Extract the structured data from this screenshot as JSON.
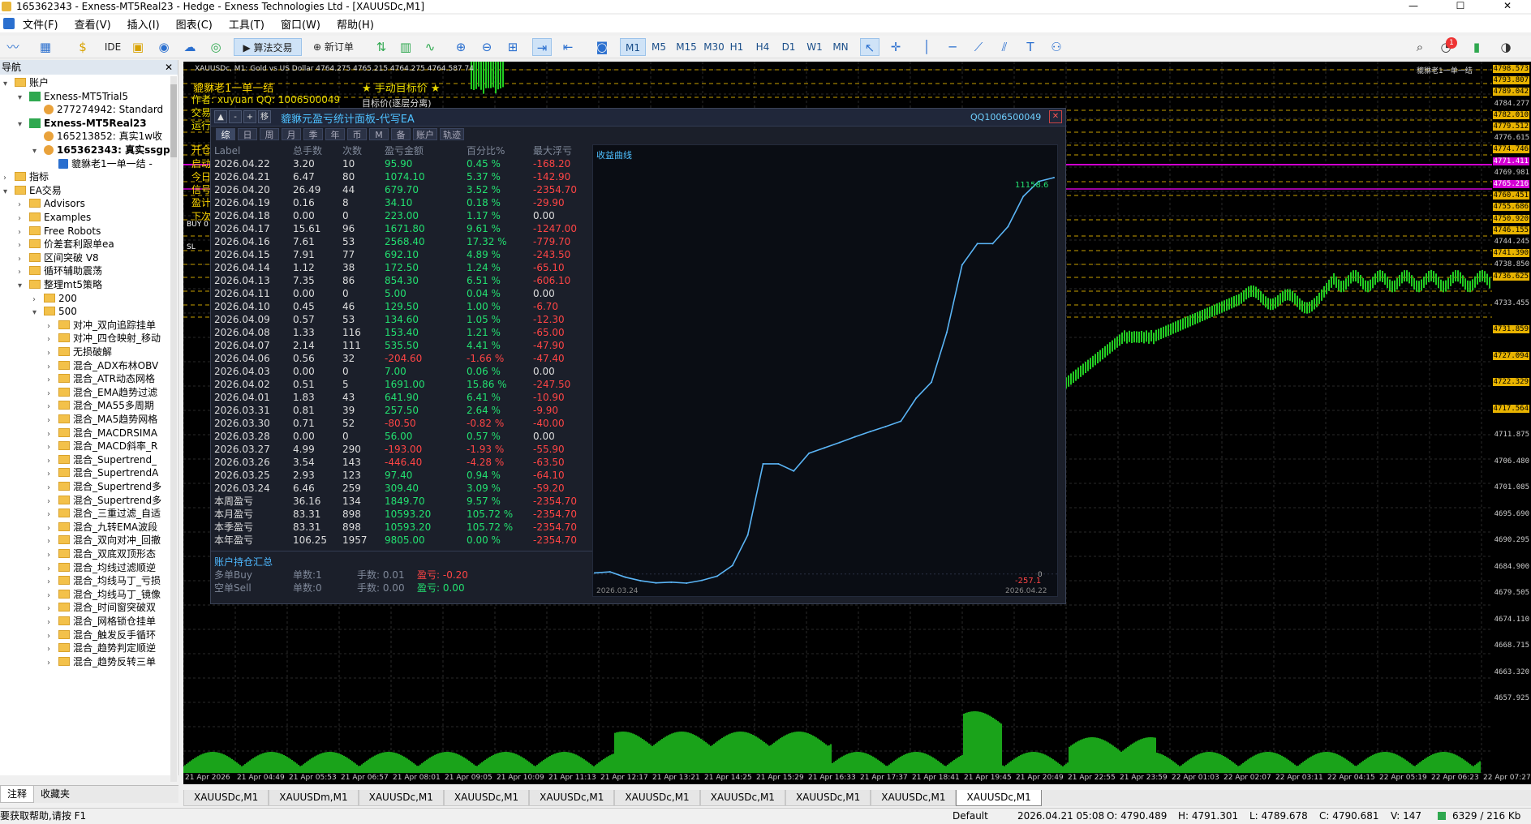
{
  "window": {
    "title": "165362343 - Exness-MT5Real23 - Hedge - Exness Technologies Ltd - [XAUUSDc,M1]",
    "minimize": "—",
    "maximize": "☐",
    "close": "✕"
  },
  "menu": [
    "文件(F)",
    "查看(V)",
    "插入(I)",
    "图表(C)",
    "工具(T)",
    "窗口(W)",
    "帮助(H)"
  ],
  "toolbar": {
    "algo": "算法交易",
    "neworder": "新订单",
    "ide": "IDE",
    "timeframes": [
      "M1",
      "M5",
      "M15",
      "M30",
      "H1",
      "H4",
      "D1",
      "W1",
      "MN"
    ],
    "active_tf": "M1",
    "notif_count": "1"
  },
  "navigator": {
    "title": "导航",
    "close": "✕",
    "items": [
      {
        "label": "账户",
        "indent": 0,
        "type": "folder",
        "exp": "▾"
      },
      {
        "label": "Exness-MT5Trial5",
        "indent": 1,
        "type": "server",
        "exp": "▾"
      },
      {
        "label": "277274942: Standard",
        "indent": 2,
        "type": "person",
        "exp": ""
      },
      {
        "label": "Exness-MT5Real23",
        "indent": 1,
        "type": "server",
        "exp": "▾",
        "bold": true
      },
      {
        "label": "165213852: 真实1w收",
        "indent": 2,
        "type": "person",
        "exp": ""
      },
      {
        "label": "165362343: 真实ssgp",
        "indent": 2,
        "type": "person",
        "exp": "▾",
        "bold": true
      },
      {
        "label": "貔貅老1一单一结 -",
        "indent": 3,
        "type": "ea",
        "exp": ""
      },
      {
        "label": "指标",
        "indent": 0,
        "type": "folder",
        "exp": "›"
      },
      {
        "label": "EA交易",
        "indent": 0,
        "type": "folder",
        "exp": "▾"
      },
      {
        "label": "Advisors",
        "indent": 1,
        "type": "folder",
        "exp": "›"
      },
      {
        "label": "Examples",
        "indent": 1,
        "type": "folder",
        "exp": "›"
      },
      {
        "label": "Free Robots",
        "indent": 1,
        "type": "folder",
        "exp": "›"
      },
      {
        "label": "价差套利跟单ea",
        "indent": 1,
        "type": "folder",
        "exp": "›"
      },
      {
        "label": "区间突破 V8",
        "indent": 1,
        "type": "folder",
        "exp": "›"
      },
      {
        "label": "循环辅助震荡",
        "indent": 1,
        "type": "folder",
        "exp": "›"
      },
      {
        "label": "整理mt5策略",
        "indent": 1,
        "type": "folder",
        "exp": "▾"
      },
      {
        "label": "200",
        "indent": 2,
        "type": "folder",
        "exp": "›"
      },
      {
        "label": "500",
        "indent": 2,
        "type": "folder",
        "exp": "▾"
      },
      {
        "label": "对冲_双向追踪挂单",
        "indent": 3,
        "type": "folder",
        "exp": "›"
      },
      {
        "label": "对冲_四仓映射_移动",
        "indent": 3,
        "type": "folder",
        "exp": "›"
      },
      {
        "label": "无损破解",
        "indent": 3,
        "type": "folder",
        "exp": "›"
      },
      {
        "label": "混合_ADX布林OBV",
        "indent": 3,
        "type": "folder",
        "exp": "›"
      },
      {
        "label": "混合_ATR动态网格",
        "indent": 3,
        "type": "folder",
        "exp": "›"
      },
      {
        "label": "混合_EMA趋势过滤",
        "indent": 3,
        "type": "folder",
        "exp": "›"
      },
      {
        "label": "混合_MA55多周期",
        "indent": 3,
        "type": "folder",
        "exp": "›"
      },
      {
        "label": "混合_MA5趋势网格",
        "indent": 3,
        "type": "folder",
        "exp": "›"
      },
      {
        "label": "混合_MACDRSIMA",
        "indent": 3,
        "type": "folder",
        "exp": "›"
      },
      {
        "label": "混合_MACD斜率_R",
        "indent": 3,
        "type": "folder",
        "exp": "›"
      },
      {
        "label": "混合_Supertrend_",
        "indent": 3,
        "type": "folder",
        "exp": "›"
      },
      {
        "label": "混合_SupertrendA",
        "indent": 3,
        "type": "folder",
        "exp": "›"
      },
      {
        "label": "混合_Supertrend多",
        "indent": 3,
        "type": "folder",
        "exp": "›"
      },
      {
        "label": "混合_Supertrend多",
        "indent": 3,
        "type": "folder",
        "exp": "›"
      },
      {
        "label": "混合_三重过滤_自适",
        "indent": 3,
        "type": "folder",
        "exp": "›"
      },
      {
        "label": "混合_九转EMA波段",
        "indent": 3,
        "type": "folder",
        "exp": "›"
      },
      {
        "label": "混合_双向对冲_回撤",
        "indent": 3,
        "type": "folder",
        "exp": "›"
      },
      {
        "label": "混合_双底双顶形态",
        "indent": 3,
        "type": "folder",
        "exp": "›"
      },
      {
        "label": "混合_均线过滤顺逆",
        "indent": 3,
        "type": "folder",
        "exp": "›"
      },
      {
        "label": "混合_均线马丁_亏损",
        "indent": 3,
        "type": "folder",
        "exp": "›"
      },
      {
        "label": "混合_均线马丁_镜像",
        "indent": 3,
        "type": "folder",
        "exp": "›"
      },
      {
        "label": "混合_时间窗突破双",
        "indent": 3,
        "type": "folder",
        "exp": "›"
      },
      {
        "label": "混合_网格锁仓挂单",
        "indent": 3,
        "type": "folder",
        "exp": "›"
      },
      {
        "label": "混合_触发反手循环",
        "indent": 3,
        "type": "folder",
        "exp": "›"
      },
      {
        "label": "混合_趋势判定顺逆",
        "indent": 3,
        "type": "folder",
        "exp": "›"
      },
      {
        "label": "混合_趋势反转三单",
        "indent": 3,
        "type": "folder",
        "exp": "›"
      }
    ],
    "tabs": [
      "注释",
      "收藏夹"
    ]
  },
  "chart": {
    "symbol_info": "XAUUSDc, M1: Gold vs US Dollar 4764.275 4765.215 4764.275 4764.587 74",
    "overlay_title": "貔貅老1一单一结",
    "overlay_author": "作者: xuyuan   QQ: 1006500049",
    "overlay_manual": "★ 手动目标价 ★",
    "overlay_target": "目标价(逐层分离)",
    "overlay_trade": "交易",
    "overlay_run": "运行",
    "ea_tag": "貔貅老1一单一结",
    "side_labels": [
      "开仓",
      "启动",
      "今日",
      "信号",
      "盈计",
      "下次"
    ],
    "buy_label": "BUY 0",
    "sl_label": "SL",
    "prices": [
      "4798.573",
      "4793.807",
      "4789.042",
      "4784.277",
      "4782.010",
      "4779.512",
      "4776.615",
      "4774.746",
      "4771.411",
      "4769.981",
      "4765.216",
      "4760.451",
      "4755.686",
      "4750.920",
      "4746.155",
      "4744.245",
      "4741.390",
      "4738.850",
      "4736.625",
      "4733.455",
      "4731.859",
      "4727.094",
      "4722.329",
      "4717.564",
      "4711.875",
      "4706.480",
      "4701.085",
      "4695.690",
      "4690.295",
      "4684.900",
      "4679.505",
      "4674.110",
      "4668.715",
      "4663.320",
      "4657.925"
    ],
    "times": [
      "21 Apr 2026",
      "21 Apr 04:49",
      "21 Apr 05:53",
      "21 Apr 06:57",
      "21 Apr 08:01",
      "21 Apr 09:05",
      "21 Apr 10:09",
      "21 Apr 11:13",
      "21 Apr 12:17",
      "21 Apr 13:21",
      "21 Apr 14:25",
      "21 Apr 15:29",
      "21 Apr 16:33",
      "21 Apr 17:37",
      "21 Apr 18:41",
      "21 Apr 19:45",
      "21 Apr 20:49",
      "21 Apr 22:55",
      "21 Apr 23:59",
      "22 Apr 01:03",
      "22 Apr 02:07",
      "22 Apr 03:11",
      "22 Apr 04:15",
      "22 Apr 05:19",
      "22 Apr 06:23",
      "22 Apr 07:27"
    ]
  },
  "panel": {
    "title": "貔貅元盈亏统计面板-代写EA",
    "qq": "QQ1006500049",
    "btns": [
      "▲",
      "-",
      "+",
      "移"
    ],
    "close": "✕",
    "tabs": [
      "综",
      "日",
      "周",
      "月",
      "季",
      "年",
      "币",
      "M",
      "备",
      "账户",
      "轨迹"
    ],
    "headers": [
      "Label",
      "总手数",
      "次数",
      "盈亏金额",
      "百分比%",
      "最大浮亏"
    ],
    "rows": [
      [
        "2026.04.22",
        "3.20",
        "10",
        "95.90",
        "0.45 %",
        "-168.20"
      ],
      [
        "2026.04.21",
        "6.47",
        "80",
        "1074.10",
        "5.37 %",
        "-142.90"
      ],
      [
        "2026.04.20",
        "26.49",
        "44",
        "679.70",
        "3.52 %",
        "-2354.70"
      ],
      [
        "2026.04.19",
        "0.16",
        "8",
        "34.10",
        "0.18 %",
        "-29.90"
      ],
      [
        "2026.04.18",
        "0.00",
        "0",
        "223.00",
        "1.17 %",
        "0.00"
      ],
      [
        "2026.04.17",
        "15.61",
        "96",
        "1671.80",
        "9.61 %",
        "-1247.00"
      ],
      [
        "2026.04.16",
        "7.61",
        "53",
        "2568.40",
        "17.32 %",
        "-779.70"
      ],
      [
        "2026.04.15",
        "7.91",
        "77",
        "692.10",
        "4.89 %",
        "-243.50"
      ],
      [
        "2026.04.14",
        "1.12",
        "38",
        "172.50",
        "1.24 %",
        "-65.10"
      ],
      [
        "2026.04.13",
        "7.35",
        "86",
        "854.30",
        "6.51 %",
        "-606.10"
      ],
      [
        "2026.04.11",
        "0.00",
        "0",
        "5.00",
        "0.04 %",
        "0.00"
      ],
      [
        "2026.04.10",
        "0.45",
        "46",
        "129.50",
        "1.00 %",
        "-6.70"
      ],
      [
        "2026.04.09",
        "0.57",
        "53",
        "134.60",
        "1.05 %",
        "-12.30"
      ],
      [
        "2026.04.08",
        "1.33",
        "116",
        "153.40",
        "1.21 %",
        "-65.00"
      ],
      [
        "2026.04.07",
        "2.14",
        "111",
        "535.50",
        "4.41 %",
        "-47.90"
      ],
      [
        "2026.04.06",
        "0.56",
        "32",
        "-204.60",
        "-1.66 %",
        "-47.40"
      ],
      [
        "2026.04.03",
        "0.00",
        "0",
        "7.00",
        "0.06 %",
        "0.00"
      ],
      [
        "2026.04.02",
        "0.51",
        "5",
        "1691.00",
        "15.86 %",
        "-247.50"
      ],
      [
        "2026.04.01",
        "1.83",
        "43",
        "641.90",
        "6.41 %",
        "-10.90"
      ],
      [
        "2026.03.31",
        "0.81",
        "39",
        "257.50",
        "2.64 %",
        "-9.90"
      ],
      [
        "2026.03.30",
        "0.71",
        "52",
        "-80.50",
        "-0.82 %",
        "-40.00"
      ],
      [
        "2026.03.28",
        "0.00",
        "0",
        "56.00",
        "0.57 %",
        "0.00"
      ],
      [
        "2026.03.27",
        "4.99",
        "290",
        "-193.00",
        "-1.93 %",
        "-55.90"
      ],
      [
        "2026.03.26",
        "3.54",
        "143",
        "-446.40",
        "-4.28 %",
        "-63.50"
      ],
      [
        "2026.03.25",
        "2.93",
        "123",
        "97.40",
        "0.94 %",
        "-64.10"
      ],
      [
        "2026.03.24",
        "6.46",
        "259",
        "309.40",
        "3.09 %",
        "-59.20"
      ],
      [
        "本周盈亏",
        "36.16",
        "134",
        "1849.70",
        "9.57 %",
        "-2354.70"
      ],
      [
        "本月盈亏",
        "83.31",
        "898",
        "10593.20",
        "105.72 %",
        "-2354.70"
      ],
      [
        "本季盈亏",
        "83.31",
        "898",
        "10593.20",
        "105.72 %",
        "-2354.70"
      ],
      [
        "本年盈亏",
        "106.25",
        "1957",
        "9805.00",
        "0.00 %",
        "-2354.70"
      ]
    ],
    "summary": {
      "label": "账户持仓汇总",
      "buy": [
        "多单Buy",
        "单数:1",
        "手数: 0.01",
        "盈亏: -0.20"
      ],
      "sell": [
        "空单Sell",
        "单数:0",
        "手数: 0.00",
        "盈亏: 0.00"
      ]
    },
    "curve": {
      "label": "收益曲线",
      "max_label": "11158.6",
      "min_label": "-257.1",
      "zero_label": "0",
      "start": "2026.03.24",
      "end": "2026.04.22",
      "values": [
        30,
        60,
        -90,
        -190,
        -250,
        -230,
        -257,
        -180,
        -60,
        240,
        1100,
        3100,
        3100,
        2900,
        3400,
        3550,
        3700,
        3860,
        4010,
        4150,
        4300,
        4950,
        5400,
        6800,
        8700,
        9300,
        9300,
        9780,
        10630,
        11050,
        11158
      ]
    }
  },
  "bottom_tabs": [
    "XAUUSDc,M1",
    "XAUUSDm,M1",
    "XAUUSDc,M1",
    "XAUUSDc,M1",
    "XAUUSDc,M1",
    "XAUUSDc,M1",
    "XAUUSDc,M1",
    "XAUUSDc,M1",
    "XAUUSDc,M1",
    "XAUUSDc,M1"
  ],
  "status": {
    "help": "要获取帮助,请按 F1",
    "profile": "Default",
    "datetime": "2026.04.21 05:08",
    "open": "O: 4790.489",
    "high": "H: 4791.301",
    "low": "L: 4789.678",
    "close": "C: 4790.681",
    "volume": "V: 147",
    "traffic": "6329 / 216 Kb"
  },
  "colors": {
    "bull": "#22cc22",
    "curve": "#5ab4f5",
    "magenta": "#d000d0",
    "gold": "#e8b300"
  }
}
